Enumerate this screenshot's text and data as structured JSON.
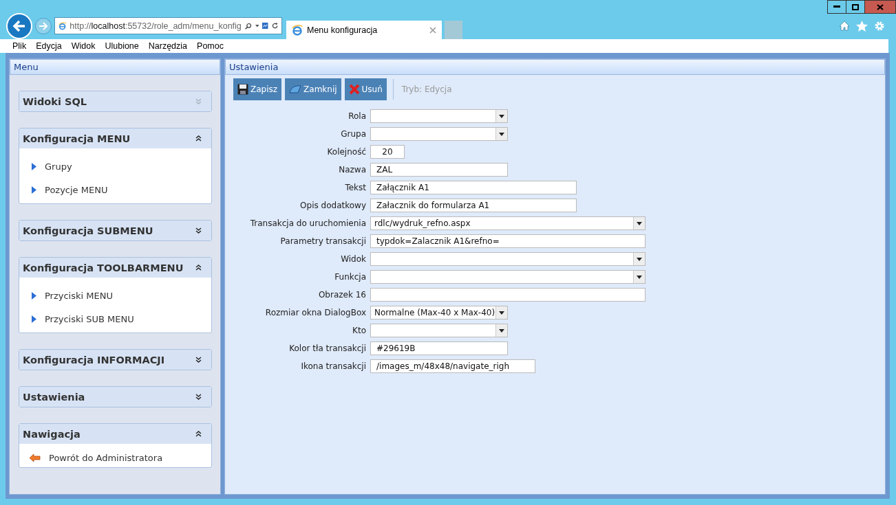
{
  "browser": {
    "url_prefix": "http://",
    "url_host": "localhost",
    "url_rest": ":55732/role_adm/menu_konfig",
    "tab_title": "Menu konfiguracja",
    "menu": [
      "Plik",
      "Edycja",
      "Widok",
      "Ulubione",
      "Narzędzia",
      "Pomoc"
    ]
  },
  "menu_panel": {
    "title": "Menu",
    "sections": [
      {
        "title": "Widoki SQL",
        "expanded": false
      },
      {
        "title": "Konfiguracja MENU",
        "expanded": true,
        "items": [
          {
            "label": "Grupy",
            "kind": "link"
          },
          {
            "label": "Pozycje MENU",
            "kind": "link"
          }
        ]
      },
      {
        "title": "Konfiguracja SUBMENU",
        "expanded": false
      },
      {
        "title": "Konfiguracja TOOLBARMENU",
        "expanded": true,
        "items": [
          {
            "label": "Przyciski MENU",
            "kind": "link"
          },
          {
            "label": "Przyciski SUB MENU",
            "kind": "link"
          }
        ]
      },
      {
        "title": "Konfiguracja INFORMACJI",
        "expanded": false
      },
      {
        "title": "Ustawienia",
        "expanded": false
      },
      {
        "title": "Nawigacja",
        "expanded": true,
        "items": [
          {
            "label": "Powrót do Administratora",
            "kind": "back"
          }
        ]
      }
    ]
  },
  "settings_panel": {
    "title": "Ustawienia",
    "toolbar": [
      {
        "label": "Zapisz",
        "kind": "save"
      },
      {
        "label": "Zamknij",
        "kind": "close"
      },
      {
        "label": "Usuń",
        "kind": "delete"
      }
    ],
    "mode": "Tryb: Edycja",
    "fields": [
      {
        "label": "Rola",
        "kind": "select"
      },
      {
        "label": "Grupa",
        "kind": "select"
      },
      {
        "label": "Kolejność",
        "kind": "number",
        "value": "20"
      },
      {
        "label": "Nazwa",
        "kind": "text",
        "value": "ZAL"
      },
      {
        "label": "Tekst",
        "kind": "text",
        "value": "Załącznik A1"
      },
      {
        "label": "Opis dodatkowy",
        "kind": "text",
        "value": "Załacznik do formularza A1"
      },
      {
        "label": "Transakcja do uruchomienia",
        "kind": "select",
        "value": "rdlc/wydruk_refno.aspx"
      },
      {
        "label": "Parametry transakcji",
        "kind": "text",
        "value": "typdok=Zalacznik A1&refno="
      },
      {
        "label": "Widok",
        "kind": "select"
      },
      {
        "label": "Funkcja",
        "kind": "select"
      },
      {
        "label": "Obrazek 16",
        "kind": "text"
      },
      {
        "label": "Rozmiar okna DialogBox",
        "kind": "select",
        "value": "Normalne (Max-40 x Max-40)"
      },
      {
        "label": "Kto",
        "kind": "select"
      },
      {
        "label": "Kolor tła transakcji",
        "kind": "text",
        "value": "#29619B"
      },
      {
        "label": "Ikona transakcji",
        "kind": "text",
        "value": "/images_m/48x48/navigate_righ"
      }
    ]
  }
}
